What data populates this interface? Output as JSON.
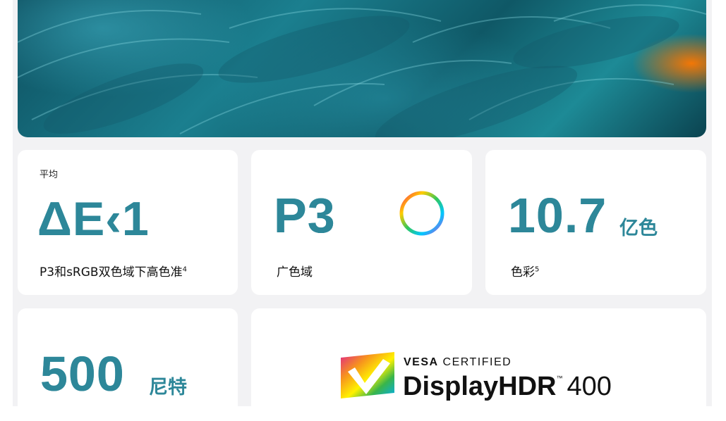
{
  "hero": {
    "image": "teal-feathers-photo"
  },
  "delta_e": {
    "label_top": "平均",
    "value": "ΔE‹1",
    "caption": "P3和sRGB双色域下高色准",
    "footnote": "4"
  },
  "gamut": {
    "value": "P3",
    "caption": "广色域",
    "icon": "color-ring-icon"
  },
  "colors": {
    "value": "10.7",
    "unit": "亿色",
    "caption": "色彩",
    "footnote": "5"
  },
  "brightness": {
    "value": "500",
    "unit": "尼特"
  },
  "hdr": {
    "brand": "VESA",
    "certified": "CERTIFIED",
    "name": "DisplayHDR",
    "tm": "™",
    "level": "400",
    "logo_icon": "vesa-displayhdr-logo"
  },
  "colors_theme": {
    "accent": "#2d8799",
    "card": "#ffffff",
    "background": "#f2f2f4"
  }
}
